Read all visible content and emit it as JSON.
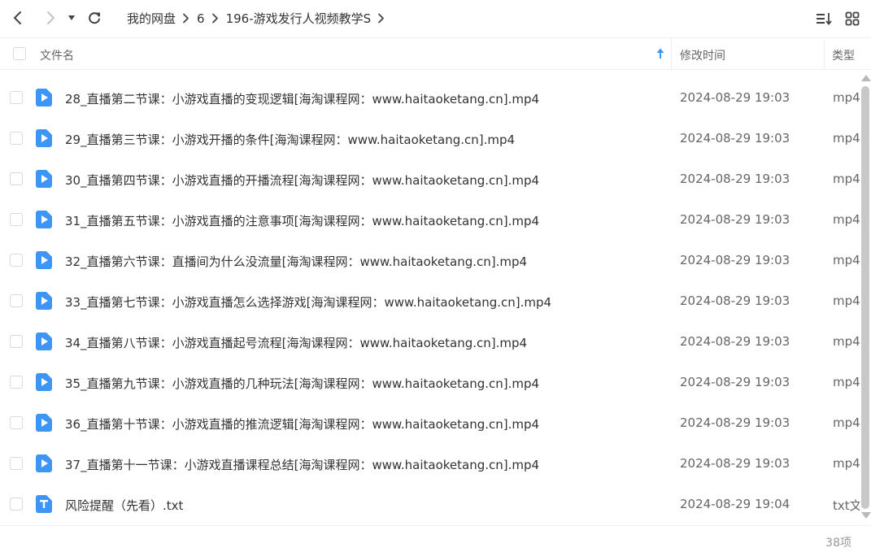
{
  "breadcrumb": [
    "我的网盘",
    "6",
    "196-游戏发行人视频教学S"
  ],
  "header": {
    "name_label": "文件名",
    "time_label": "修改时间",
    "type_label": "类型"
  },
  "colors": {
    "video_icon": "#3d95f5",
    "text_icon": "#3d95f5",
    "sort_arrow": "#3d95f5"
  },
  "files": [
    {
      "name": "28_直播第二节课：小游戏直播的变现逻辑[海淘课程网：www.haitaoketang.cn].mp4",
      "time": "2024-08-29 19:03",
      "type": "mp4",
      "icon": "video-file-icon"
    },
    {
      "name": "29_直播第三节课：小游戏开播的条件[海淘课程网：www.haitaoketang.cn].mp4",
      "time": "2024-08-29 19:03",
      "type": "mp4",
      "icon": "video-file-icon"
    },
    {
      "name": "30_直播第四节课：小游戏直播的开播流程[海淘课程网：www.haitaoketang.cn].mp4",
      "time": "2024-08-29 19:03",
      "type": "mp4",
      "icon": "video-file-icon"
    },
    {
      "name": "31_直播第五节课：小游戏直播的注意事项[海淘课程网：www.haitaoketang.cn].mp4",
      "time": "2024-08-29 19:03",
      "type": "mp4",
      "icon": "video-file-icon"
    },
    {
      "name": "32_直播第六节课：直播间为什么没流量[海淘课程网：www.haitaoketang.cn].mp4",
      "time": "2024-08-29 19:03",
      "type": "mp4",
      "icon": "video-file-icon"
    },
    {
      "name": "33_直播第七节课：小游戏直播怎么选择游戏[海淘课程网：www.haitaoketang.cn].mp4",
      "time": "2024-08-29 19:03",
      "type": "mp4",
      "icon": "video-file-icon"
    },
    {
      "name": "34_直播第八节课：小游戏直播起号流程[海淘课程网：www.haitaoketang.cn].mp4",
      "time": "2024-08-29 19:03",
      "type": "mp4",
      "icon": "video-file-icon"
    },
    {
      "name": "35_直播第九节课：小游戏直播的几种玩法[海淘课程网：www.haitaoketang.cn].mp4",
      "time": "2024-08-29 19:03",
      "type": "mp4",
      "icon": "video-file-icon"
    },
    {
      "name": "36_直播第十节课：小游戏直播的推流逻辑[海淘课程网：www.haitaoketang.cn].mp4",
      "time": "2024-08-29 19:03",
      "type": "mp4",
      "icon": "video-file-icon"
    },
    {
      "name": "37_直播第十一节课：小游戏直播课程总结[海淘课程网：www.haitaoketang.cn].mp4",
      "time": "2024-08-29 19:03",
      "type": "mp4",
      "icon": "video-file-icon"
    },
    {
      "name": "风险提醒（先看）.txt",
      "time": "2024-08-29 19:04",
      "type": "txt文",
      "icon": "text-file-icon"
    }
  ],
  "footer": {
    "count": "38项"
  }
}
